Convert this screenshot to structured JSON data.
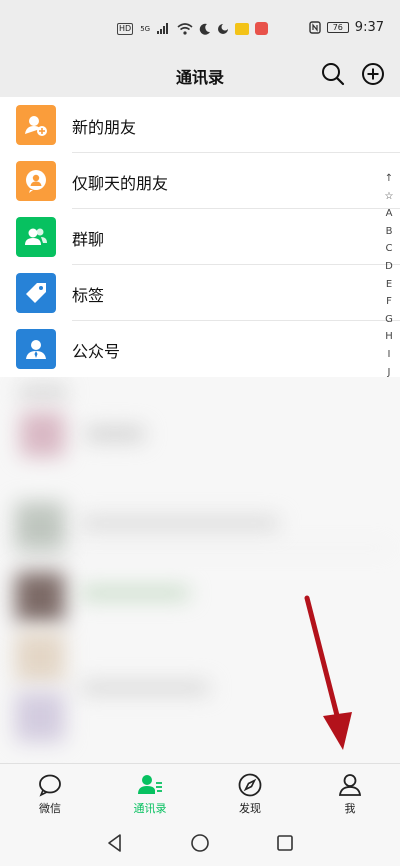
{
  "status_bar": {
    "left_chips": [
      "HD",
      "5G"
    ],
    "battery": "76",
    "time": "9:37"
  },
  "header": {
    "title": "通讯录",
    "icons": [
      "search-icon",
      "add-circle-icon"
    ]
  },
  "menu_items": [
    {
      "label": "新的朋友",
      "icon": "new-friend-icon",
      "color": "#fa9d3b"
    },
    {
      "label": "仅聊天的朋友",
      "icon": "chat-only-friend-icon",
      "color": "#fa9d3b"
    },
    {
      "label": "群聊",
      "icon": "group-chat-icon",
      "color": "#07c160"
    },
    {
      "label": "标签",
      "icon": "tag-icon",
      "color": "#2782d7"
    },
    {
      "label": "公众号",
      "icon": "official-account-icon",
      "color": "#2782d7"
    }
  ],
  "index_bar": [
    "↑",
    "☆",
    "A",
    "B",
    "C",
    "D",
    "E",
    "F",
    "G",
    "H",
    "I",
    "J"
  ],
  "tabs": [
    {
      "label": "微信",
      "icon": "chat-bubble-icon",
      "active": false
    },
    {
      "label": "通讯录",
      "icon": "contacts-icon",
      "active": true
    },
    {
      "label": "发现",
      "icon": "compass-icon",
      "active": false
    },
    {
      "label": "我",
      "icon": "person-icon",
      "active": false
    }
  ],
  "colors": {
    "accent": "#07c160",
    "background": "#ededed",
    "annotation_arrow": "#b3121b"
  }
}
